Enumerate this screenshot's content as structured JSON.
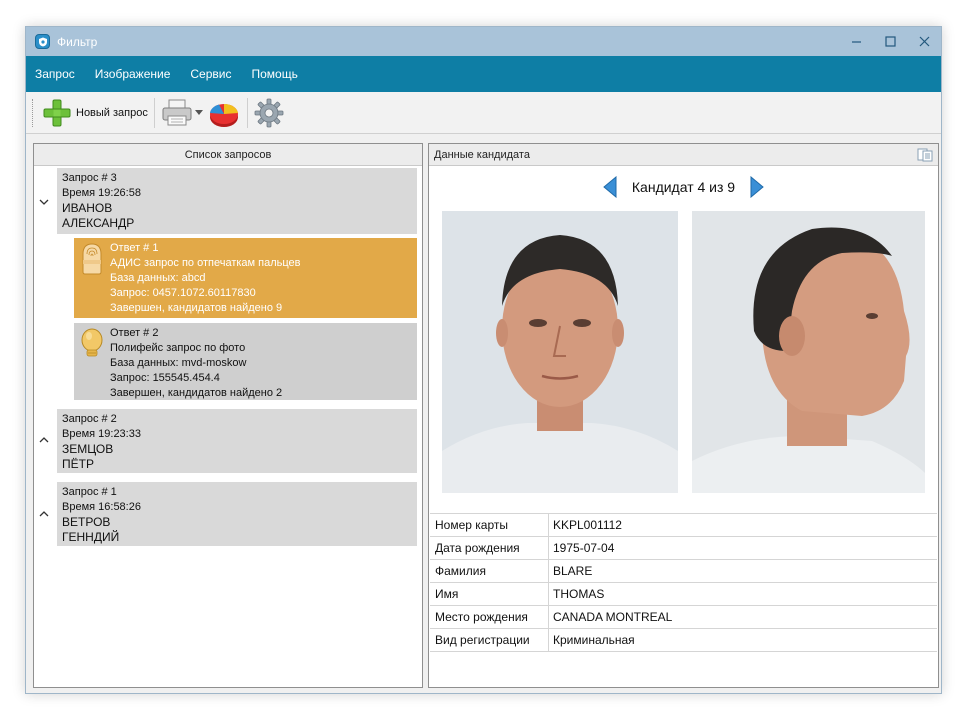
{
  "window": {
    "title": "Фильтр"
  },
  "menu": [
    "Запрос",
    "Изображение",
    "Сервис",
    "Помощь"
  ],
  "toolbar": {
    "new_request_label": "Новый запрос",
    "icons": [
      "add-icon",
      "printer-icon",
      "dropdown-arrow-icon",
      "chart-icon",
      "gear-icon"
    ]
  },
  "left_panel": {
    "header": "Список запросов",
    "requests": [
      {
        "title": "Запрос # 3",
        "time": "Время 19:26:58",
        "surname": "ИВАНОВ",
        "name": "АЛЕКСАНДР",
        "expanded": true
      },
      {
        "title": "Запрос # 2",
        "time": "Время 19:23:33",
        "surname": "ЗЕМЦОВ",
        "name": "ПЁТР",
        "expanded": false
      },
      {
        "title": "Запрос # 1",
        "time": "Время 16:58:26",
        "surname": "ВЕТРОВ",
        "name": "ГЕННДИЙ",
        "expanded": false
      }
    ],
    "responses": [
      {
        "title": "Ответ # 1",
        "type": "АДИС запрос по отпечаткам пальцев",
        "db": "База данных: abcd",
        "query": "Запрос: 0457.1072.60117830",
        "status": "Завершен, кандидатов найдено 9",
        "selected": true,
        "icon": "fingerprint-icon"
      },
      {
        "title": "Ответ # 2",
        "type": "Полифейс запрос по фото",
        "db": "База данных: mvd-moskow",
        "query": "Запрос: 155545.454.4",
        "status": "Завершен, кандидатов найдено 2",
        "selected": false,
        "icon": "face-icon"
      }
    ]
  },
  "right_panel": {
    "header": "Данные кандидата",
    "candidate_nav": "Кандидат 4 из 9",
    "details": [
      {
        "label": "Номер карты",
        "value": "KKPL001112"
      },
      {
        "label": "Дата рождения",
        "value": "1975-07-04"
      },
      {
        "label": "Фамилия",
        "value": "BLARE"
      },
      {
        "label": "Имя",
        "value": "THOMAS"
      },
      {
        "label": "Место рождения",
        "value": "CANADA MONTREAL"
      },
      {
        "label": "Вид регистрации",
        "value": "Криминальная"
      }
    ]
  },
  "colors": {
    "menubar": "#0e7ea5",
    "titlebar": "#a9c3d9",
    "selected_response": "#e2a948",
    "request_bg": "#d9d9d9"
  }
}
